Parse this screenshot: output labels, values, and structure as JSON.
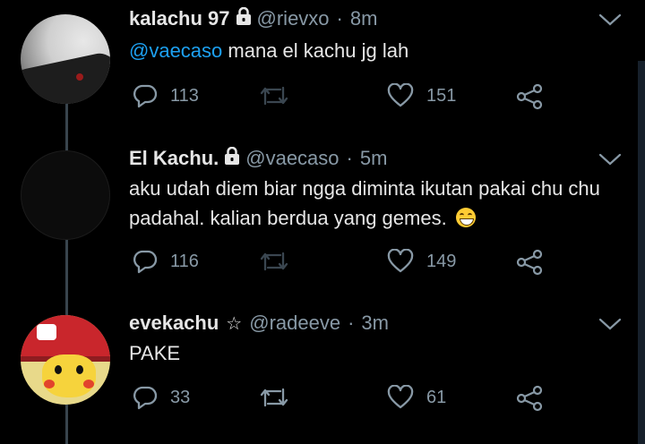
{
  "tweets": [
    {
      "name": "kalachu 97",
      "locked": true,
      "handle": "@rievxo",
      "sep": "·",
      "time": "8m",
      "mention": "@vaecaso",
      "text": " mana el kachu jg lah",
      "replies": "113",
      "retweets": "",
      "likes": "151"
    },
    {
      "name": "El Kachu.",
      "locked": true,
      "handle": "@vaecaso",
      "sep": "·",
      "time": "5m",
      "text": "aku udah diem biar ngga diminta ikutan pakai chu chu padahal. kalian berdua yang gemes.",
      "replies": "116",
      "retweets": "",
      "likes": "149"
    },
    {
      "name": "evekachu",
      "star": "☆",
      "handle": "@radeeve",
      "sep": "·",
      "time": "3m",
      "text": "PAKE",
      "replies": "33",
      "retweets": "",
      "likes": "61"
    }
  ],
  "icons": {
    "reply": "reply-icon",
    "retweet": "retweet-icon",
    "like": "heart-icon",
    "share": "share-icon",
    "lock": "lock-icon",
    "more": "chevron-down-icon"
  },
  "colors": {
    "background": "#000000",
    "accent": "#1da1f2",
    "muted": "#8899a6",
    "thread_line": "#38444d"
  }
}
